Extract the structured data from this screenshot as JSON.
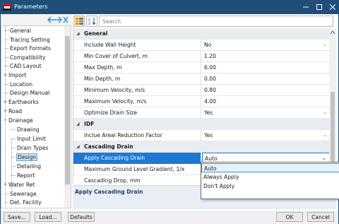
{
  "window": {
    "title": "Parameters",
    "controls": [
      "minimize",
      "maximize",
      "close"
    ]
  },
  "search": {
    "placeholder": "Search"
  },
  "tree": {
    "items": [
      {
        "label": "General",
        "toggle": ""
      },
      {
        "label": "Tracing Setting",
        "toggle": ""
      },
      {
        "label": "Export Formats",
        "toggle": ""
      },
      {
        "label": "Compatibility",
        "toggle": ""
      },
      {
        "label": "CAD Layout",
        "toggle": ""
      },
      {
        "label": "Import",
        "toggle": "+"
      },
      {
        "label": "Location",
        "toggle": ""
      },
      {
        "label": "Design Manual",
        "toggle": ""
      },
      {
        "label": "Earthworks",
        "toggle": "+"
      },
      {
        "label": "Road",
        "toggle": "+"
      },
      {
        "label": "Drainage",
        "toggle": "−"
      },
      {
        "label": "Drawing",
        "toggle": ""
      },
      {
        "label": "Input Limit",
        "toggle": ""
      },
      {
        "label": "Drain Types",
        "toggle": ""
      },
      {
        "label": "Design",
        "toggle": ""
      },
      {
        "label": "Detailing",
        "toggle": ""
      },
      {
        "label": "Report",
        "toggle": ""
      },
      {
        "label": "Water Ret",
        "toggle": "+"
      },
      {
        "label": "Sewerage",
        "toggle": ""
      },
      {
        "label": "Det. Facility",
        "toggle": ""
      }
    ],
    "selected": "Design"
  },
  "grid": {
    "sections": [
      {
        "name": "General",
        "rows": [
          {
            "name": "Include Wall Height",
            "value": "No",
            "dropdown": true
          },
          {
            "name": "Min Cover of Culvert, m",
            "value": "1.20",
            "dropdown": false
          },
          {
            "name": "Max Depth, m",
            "value": "6.00",
            "dropdown": false
          },
          {
            "name": "Min Depth, m",
            "value": "0.00",
            "dropdown": false
          },
          {
            "name": "Minimum Velocity, m/s",
            "value": "0.80",
            "dropdown": false
          },
          {
            "name": "Maximum Velocity, m/s",
            "value": "4.00",
            "dropdown": false
          },
          {
            "name": "Optimize Drain Size",
            "value": "Yes",
            "dropdown": true
          }
        ]
      },
      {
        "name": "IDF",
        "rows": [
          {
            "name": "Inclue Areal Reduction Factor",
            "value": "Yes",
            "dropdown": true
          }
        ]
      },
      {
        "name": "Cascading Drain",
        "rows": [
          {
            "name": "Apply Cascading Drain",
            "value": "Auto",
            "dropdown": true
          },
          {
            "name": "Maximum Ground Level Gradient, 1/x",
            "value": "",
            "dropdown": false
          },
          {
            "name": "Cascading Drop, mm",
            "value": "",
            "dropdown": false
          }
        ]
      }
    ],
    "selected_row": "Apply Cascading Drain"
  },
  "dropdown_options": [
    "Auto",
    "Always Apply",
    "Don't Apply"
  ],
  "dropdown_highlighted": "Auto",
  "description": {
    "title": "Apply Cascading Drain"
  },
  "buttons": {
    "save": "Save...",
    "load": "Load...",
    "defaults": "Defaults",
    "ok": "OK",
    "cancel": "Cancel"
  },
  "colors": {
    "titlebar": "#1f4e79",
    "selection": "#1e79d4",
    "category_bg": "#e9ecf1",
    "description_bg": "#e9eef5"
  }
}
